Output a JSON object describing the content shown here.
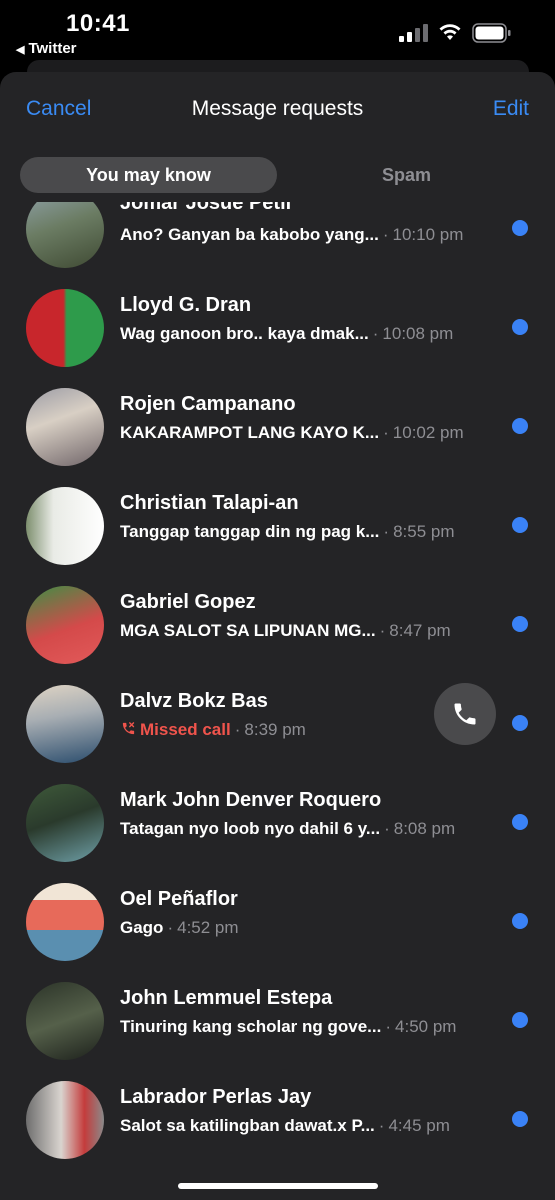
{
  "status_bar": {
    "time": "10:41",
    "back_app": "Twitter",
    "icons": [
      "signal-icon",
      "wifi-icon",
      "battery-icon"
    ]
  },
  "nav": {
    "cancel": "Cancel",
    "title": "Message requests",
    "edit": "Edit"
  },
  "tabs": {
    "active": "You may know",
    "inactive": "Spam"
  },
  "colors": {
    "accent": "#3a8bf4",
    "unread_dot": "#3a82f6",
    "missed_call": "#f0544c",
    "background": "#242426"
  },
  "requests": [
    {
      "name": "Jomar Josue Petil",
      "message": "Ano? Ganyan ba kabobo yang...",
      "time": "10:10 pm"
    },
    {
      "name": "Lloyd G. Dran",
      "message": "Wag ganoon bro.. kaya dmak...",
      "time": "10:08 pm"
    },
    {
      "name": "Rojen Campanano",
      "message": "KAKARAMPOT LANG KAYO K...",
      "time": "10:02 pm"
    },
    {
      "name": "Christian Talapi-an",
      "message": "Tanggap tanggap din ng pag k...",
      "time": "8:55 pm"
    },
    {
      "name": "Gabriel Gopez",
      "message": "MGA SALOT SA LIPUNAN MG...",
      "time": "8:47 pm"
    },
    {
      "name": "Dalvz Bokz Bas",
      "message": "Missed call",
      "time": "8:39 pm",
      "missed_call": true
    },
    {
      "name": "Mark John Denver Roquero",
      "message": "Tatagan nyo loob nyo dahil 6 y...",
      "time": "8:08 pm"
    },
    {
      "name": "Oel Peñaflor",
      "message": "Gago",
      "time": "4:52 pm"
    },
    {
      "name": "John Lemmuel Estepa",
      "message": "Tinuring kang scholar ng gove...",
      "time": "4:50 pm"
    },
    {
      "name": "Labrador Perlas Jay",
      "message": "Salot sa katilingban dawat.x P...",
      "time": "4:45 pm"
    }
  ]
}
